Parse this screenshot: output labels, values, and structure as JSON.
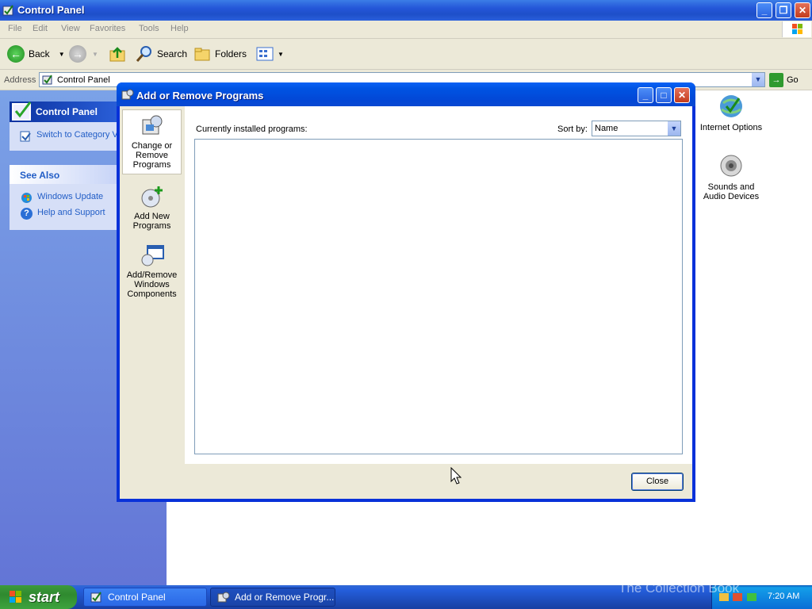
{
  "window": {
    "title": "Control Panel"
  },
  "menu": [
    "File",
    "Edit",
    "View",
    "Favorites",
    "Tools",
    "Help"
  ],
  "toolbar": {
    "back": "Back",
    "search": "Search",
    "folders": "Folders"
  },
  "address": {
    "label": "Address",
    "value": "Control Panel",
    "go": "Go"
  },
  "taskpane": {
    "title": "Control Panel",
    "switch_link": "Switch to Category View",
    "see_also_title": "See Also",
    "see_also": [
      "Windows Update",
      "Help and Support"
    ]
  },
  "content_icons": [
    {
      "label": "Internet Options",
      "icon": "internet-options-icon"
    },
    {
      "label": "Sounds and Audio Devices",
      "icon": "speaker-icon"
    }
  ],
  "dialog": {
    "title": "Add or Remove Programs",
    "nav": [
      "Change or Remove Programs",
      "Add New Programs",
      "Add/Remove Windows Components"
    ],
    "installed_label": "Currently installed programs:",
    "sort_label": "Sort by:",
    "sort_value": "Name",
    "close_button": "Close"
  },
  "taskbar": {
    "start": "start",
    "items": [
      "Control Panel",
      "Add or Remove Progr..."
    ],
    "clock": "7:20 AM",
    "watermark": "The Collection Book"
  },
  "colors": {
    "titlebar": "#0054e3",
    "taskpane": "#6375d6",
    "start": "#2f8a2f"
  }
}
